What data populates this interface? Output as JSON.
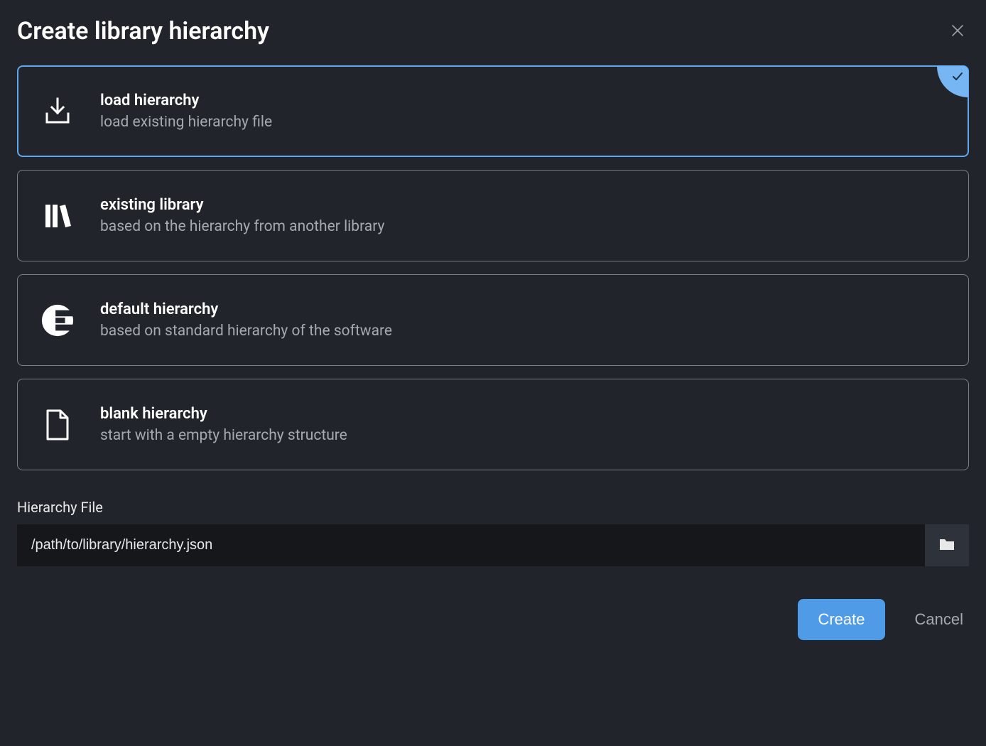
{
  "dialog": {
    "title": "Create library hierarchy"
  },
  "options": [
    {
      "title": "load hierarchy",
      "description": "load existing hierarchy file",
      "selected": true
    },
    {
      "title": "existing library",
      "description": "based on the hierarchy from another library",
      "selected": false
    },
    {
      "title": "default hierarchy",
      "description": "based on standard hierarchy of the software",
      "selected": false
    },
    {
      "title": "blank hierarchy",
      "description": "start with a empty hierarchy structure",
      "selected": false
    }
  ],
  "field": {
    "label": "Hierarchy File",
    "value": "/path/to/library/hierarchy.json"
  },
  "buttons": {
    "create": "Create",
    "cancel": "Cancel"
  }
}
